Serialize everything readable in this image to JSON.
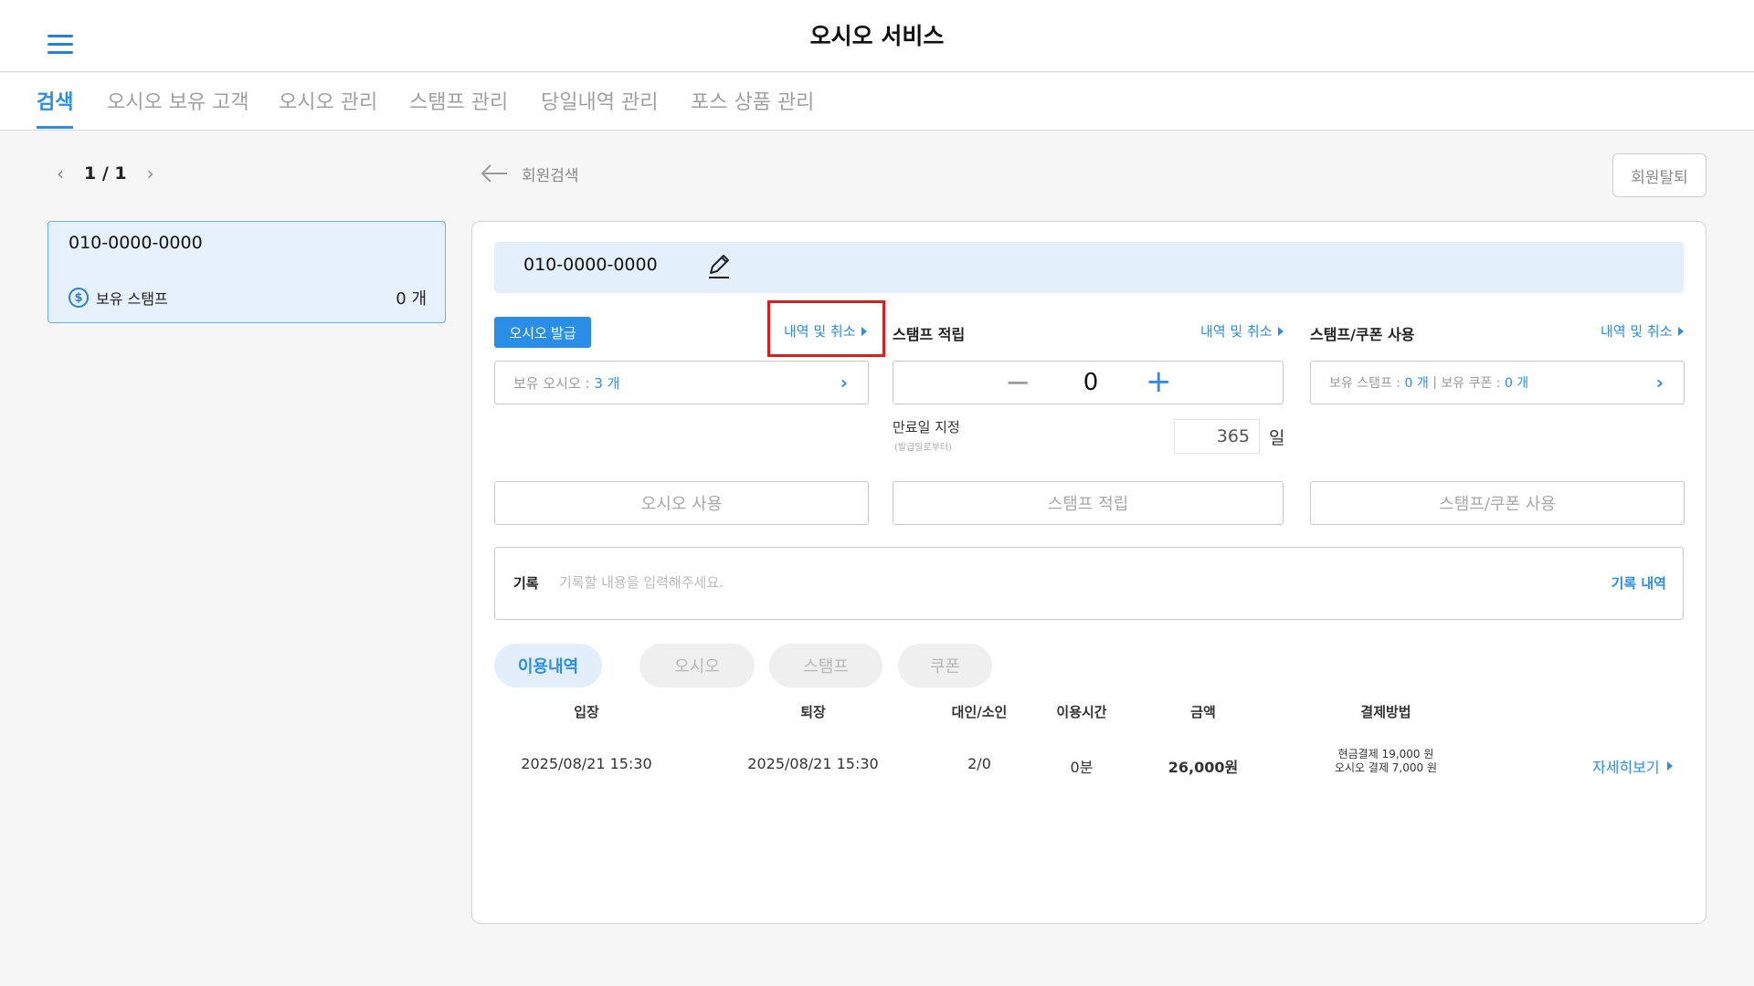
{
  "header": {
    "title": "오시오 서비스",
    "menu_icon": "hamburger-menu-icon"
  },
  "tabs": [
    {
      "label": "검색",
      "active": true
    },
    {
      "label": "오시오 보유 고객",
      "active": false
    },
    {
      "label": "오시오 관리",
      "active": false
    },
    {
      "label": "스탬프 관리",
      "active": false
    },
    {
      "label": "당일내역 관리",
      "active": false
    },
    {
      "label": "포스 상품 관리",
      "active": false
    }
  ],
  "pager": {
    "prev": "‹",
    "label": "1 / 1",
    "next": "›"
  },
  "member_list": [
    {
      "phone": "010-0000-0000",
      "stamp_label": "보유 스탬프",
      "stamp_count": "0 개",
      "coin_glyph": "$"
    }
  ],
  "top": {
    "back_label": "회원검색",
    "withdraw_label": "회원탈퇴"
  },
  "member": {
    "phone": "010-0000-0000"
  },
  "osio": {
    "issue_label": "오시오 발급",
    "history_link": "내역 및 취소",
    "held_prefix": "보유 오시오 : ",
    "held_value": "3 개",
    "use_label": "오시오 사용"
  },
  "stamp_earn": {
    "title": "스탬프 적립",
    "history_link": "내역 및 취소",
    "minus": "−",
    "value": "0",
    "plus": "+",
    "expiry_label": "만료일 지정",
    "expiry_sub": "(발급일로부터)",
    "expiry_value": "365",
    "expiry_unit": "일",
    "action_label": "스탬프 적립"
  },
  "stamp_coupon": {
    "title": "스탬프/쿠폰 사용",
    "history_link": "내역 및 취소",
    "held_stamp_prefix": "보유 스탬프 : ",
    "held_stamp_value": "0 개",
    "separator": "|",
    "held_coupon_prefix": "보유 쿠폰 : ",
    "held_coupon_value": "0 개",
    "action_label": "스탬프/쿠폰 사용"
  },
  "record": {
    "label": "기록",
    "placeholder": "기록할 내용을 입력해주세요.",
    "history_link": "기록 내역"
  },
  "history_tabs": [
    {
      "label": "이용내역",
      "active": true
    },
    {
      "label": "오시오",
      "active": false
    },
    {
      "label": "스탬프",
      "active": false
    },
    {
      "label": "쿠폰",
      "active": false
    }
  ],
  "table": {
    "headers": [
      "입장",
      "퇴장",
      "대인/소인",
      "이용시간",
      "금액",
      "결제방법"
    ],
    "rows": [
      {
        "entry": "2025/08/21 15:30",
        "exit": "2025/08/21 15:30",
        "people": "2/0",
        "duration": "0분",
        "amount": "26,000원",
        "pay_line1": "현금결제 19,000 원",
        "pay_line2": "오시오 결제 7,000 원",
        "detail": "자세히보기"
      }
    ]
  },
  "colors": {
    "accent": "#2a8ee6",
    "highlight": "#d81e1e"
  }
}
